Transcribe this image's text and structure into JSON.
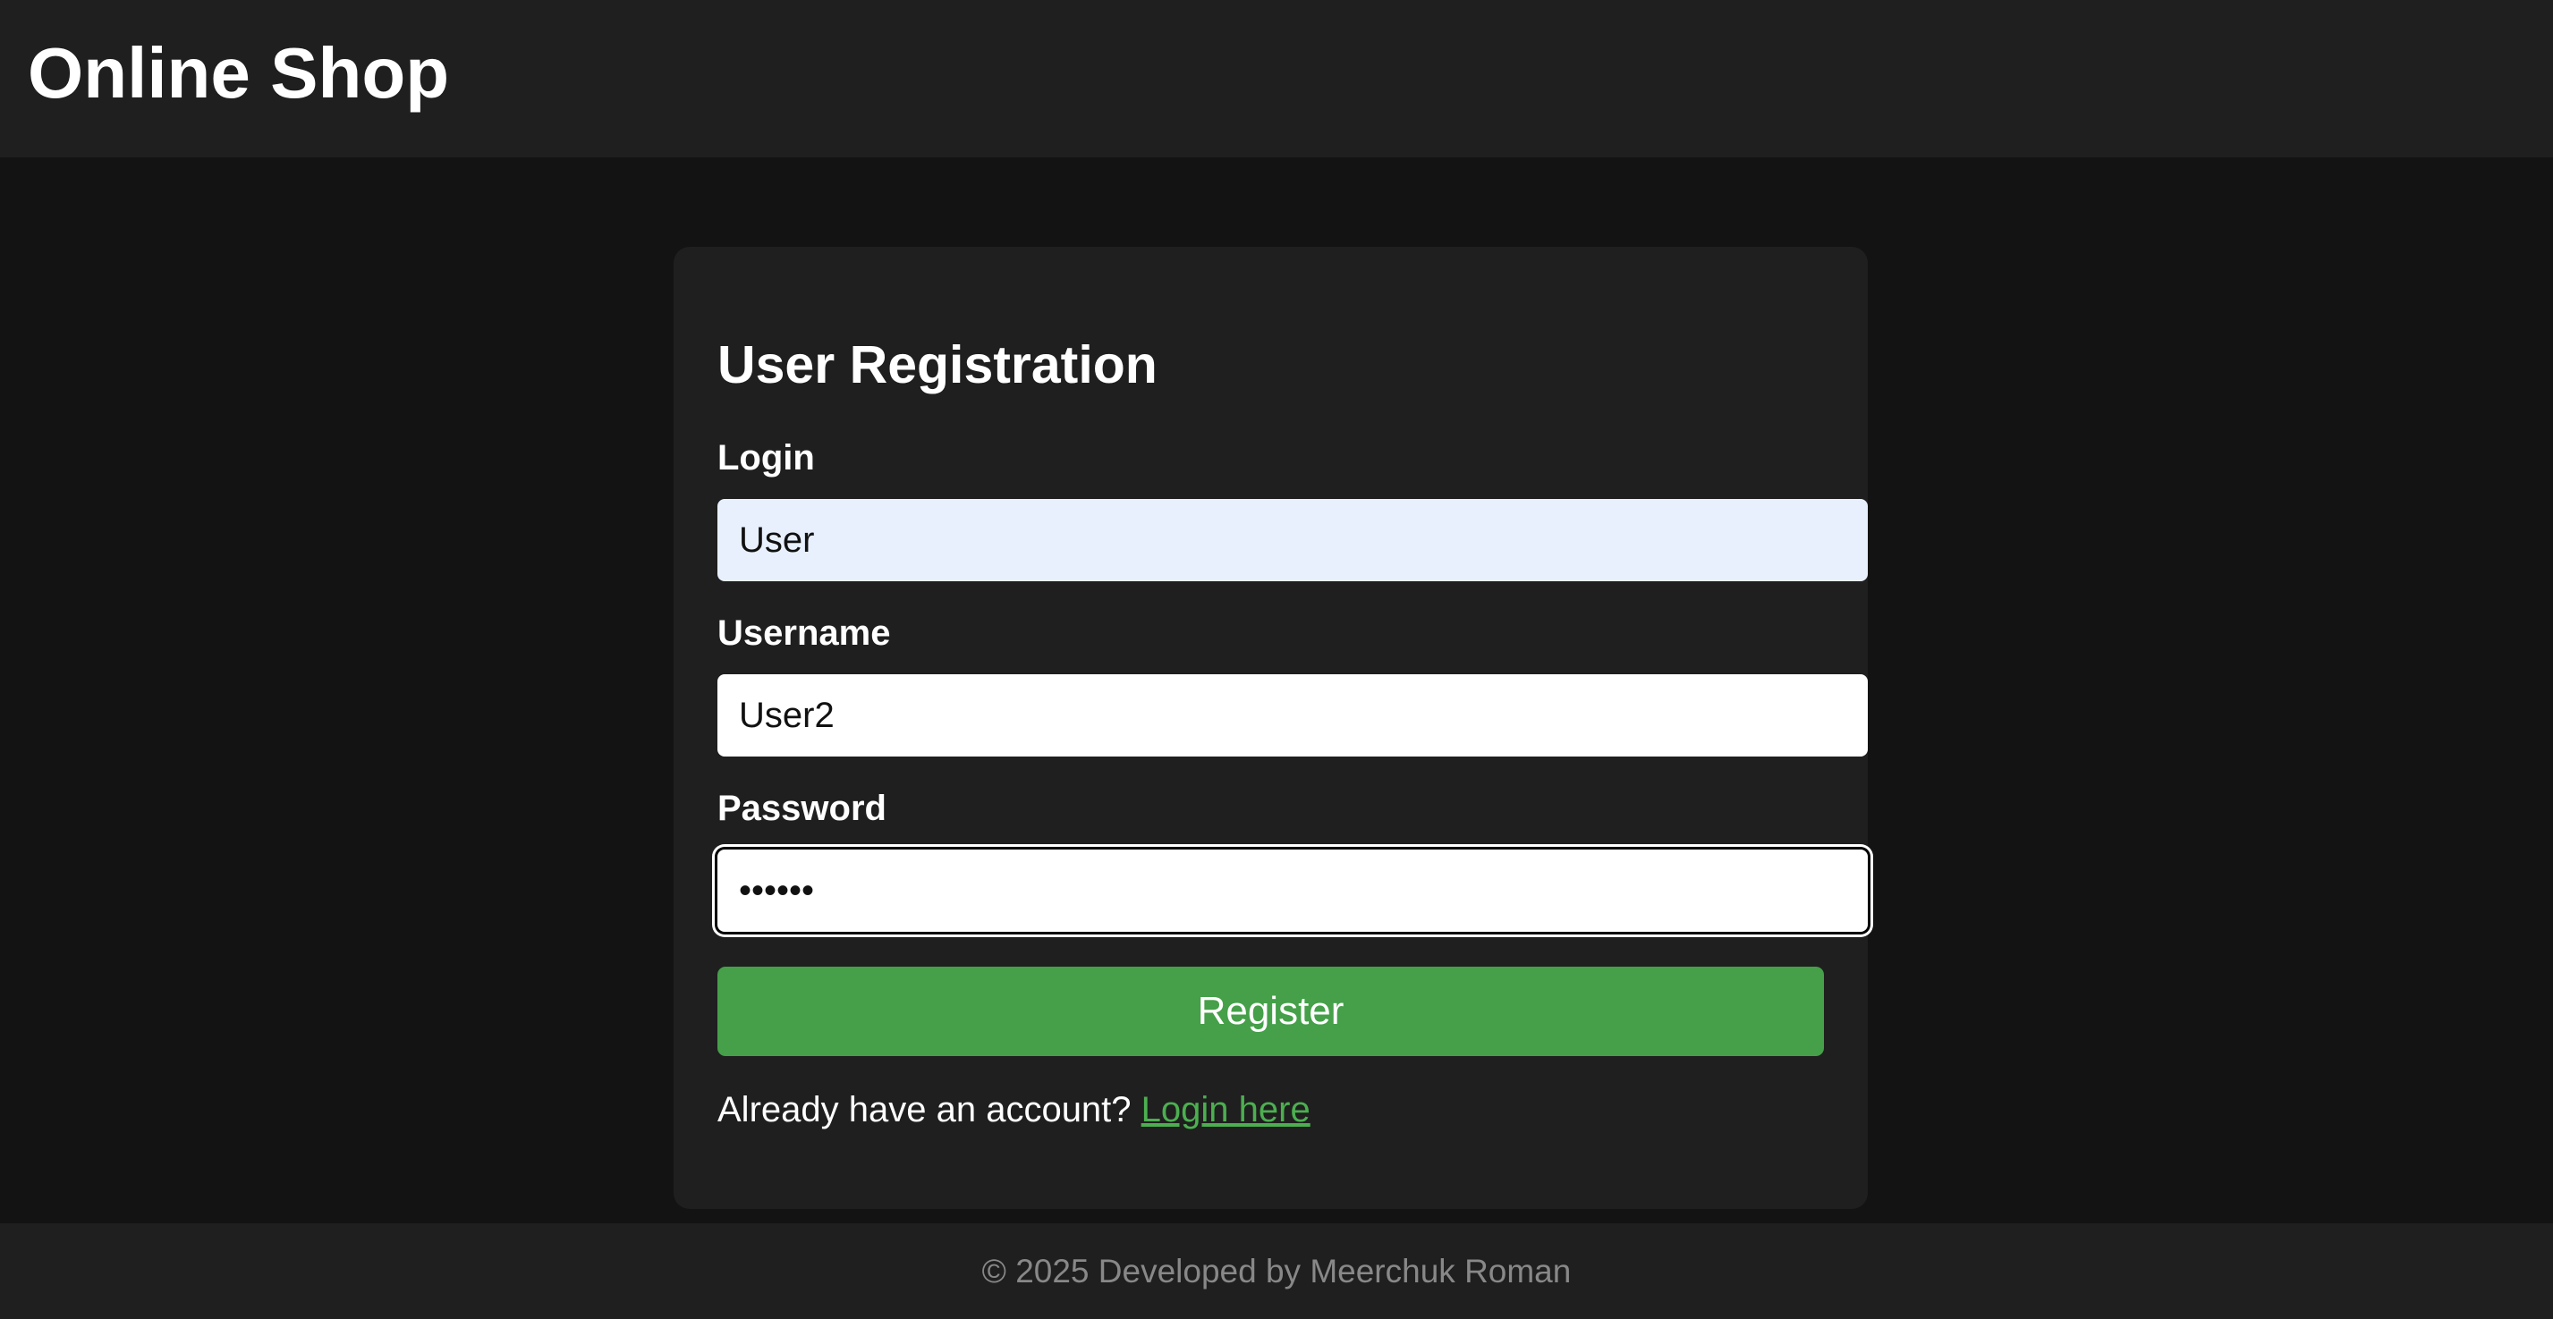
{
  "header": {
    "title": "Online Shop"
  },
  "form": {
    "title": "User Registration",
    "fields": [
      {
        "label": "Login",
        "value": "User"
      },
      {
        "label": "Username",
        "value": "User2"
      },
      {
        "label": "Password",
        "value": "••••••"
      }
    ],
    "submit_label": "Register",
    "login_prompt": "Already have an account?",
    "login_link": "Login here"
  },
  "footer": {
    "text": "© 2025 Developed by Meerchuk Roman"
  },
  "colors": {
    "page_background": "#131313",
    "panel_background": "#1f1f1f",
    "button": "#45a049",
    "link": "#4caf50",
    "autofill_background": "#e8f0fe"
  }
}
